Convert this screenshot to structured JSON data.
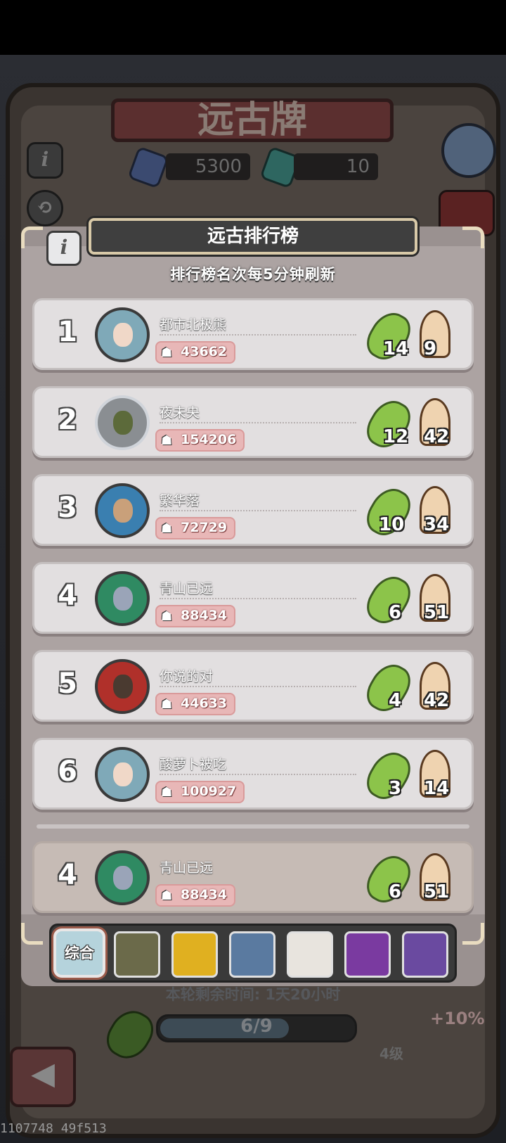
{
  "header": {
    "title": "远古牌",
    "resource_blue": "5300",
    "resource_green": "10"
  },
  "dialog": {
    "title": "远古排行榜",
    "subtitle": "排行榜名次每5分钟刷新",
    "info_icon": "i"
  },
  "rankings": [
    {
      "rank": "1",
      "name": "都市北极熊",
      "power": "43662",
      "beans": "14",
      "knights": "9"
    },
    {
      "rank": "2",
      "name": "夜未央",
      "power": "154206",
      "beans": "12",
      "knights": "42"
    },
    {
      "rank": "3",
      "name": "繁华落",
      "power": "72729",
      "beans": "10",
      "knights": "34"
    },
    {
      "rank": "4",
      "name": "青山已远",
      "power": "88434",
      "beans": "6",
      "knights": "51"
    },
    {
      "rank": "5",
      "name": "你说的对",
      "power": "44633",
      "beans": "4",
      "knights": "42"
    },
    {
      "rank": "6",
      "name": "酸萝卜被吃",
      "power": "100927",
      "beans": "3",
      "knights": "14"
    }
  ],
  "self_row": {
    "rank": "4",
    "name": "青山已远",
    "power": "88434",
    "beans": "6",
    "knights": "51"
  },
  "tabs": {
    "all_label": "综合"
  },
  "footer": {
    "timer": "本轮剩余时间: 1天20小时",
    "progress_text": "6/9",
    "progress_value": 0.667,
    "level": "4级",
    "bonus": "+10%",
    "debug_id": "1107748 49f513",
    "back_icon": "back-arrow"
  },
  "colors": {
    "bean": "#8cc44a",
    "power_badge": "#e8b7b7",
    "dialog_bg": "#aca3a2",
    "row_bg": "#e2dfe0"
  }
}
